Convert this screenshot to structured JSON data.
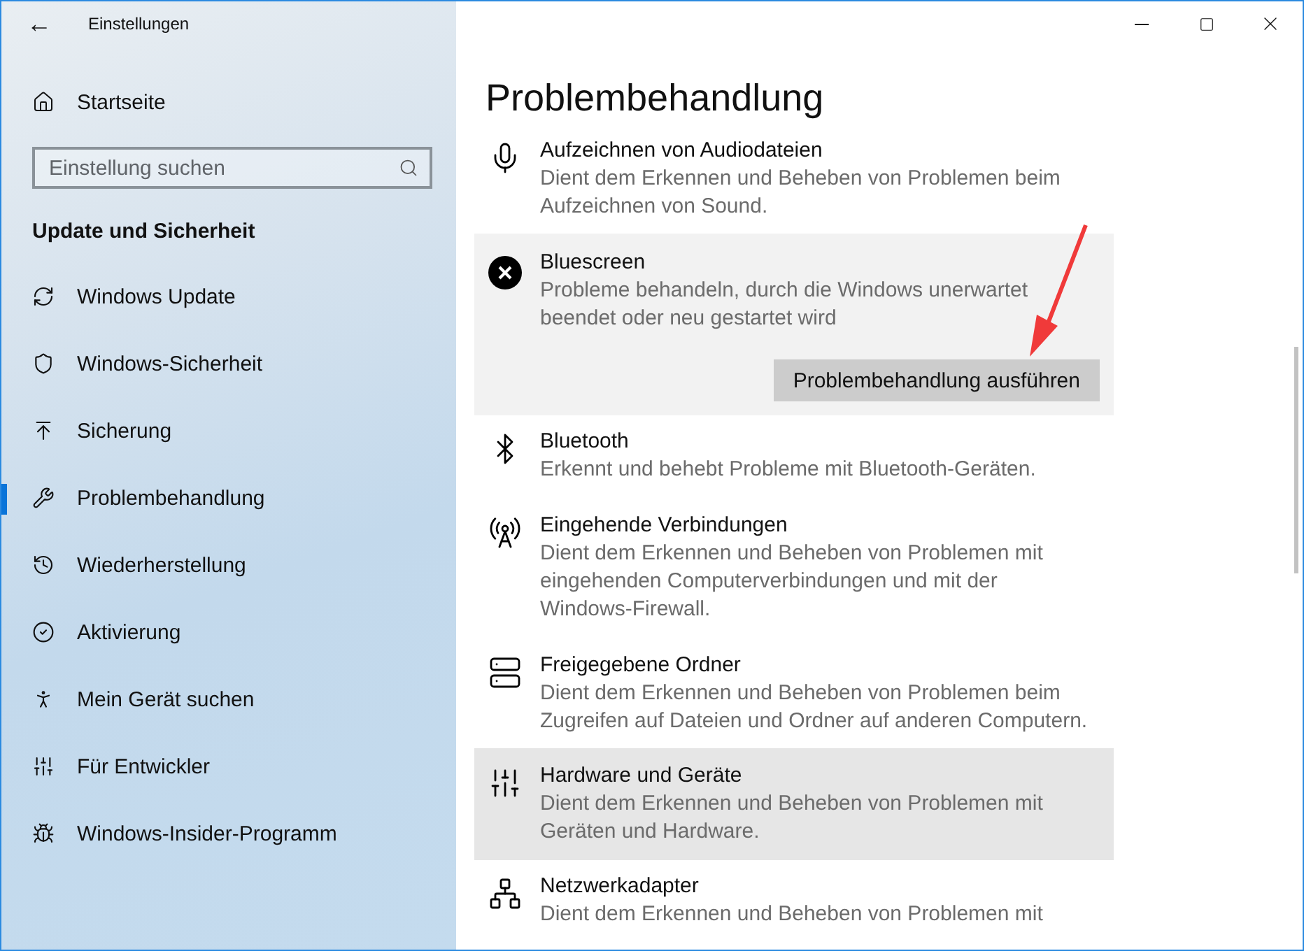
{
  "window": {
    "title": "Einstellungen",
    "back": "←"
  },
  "sidebar": {
    "home": "Startseite",
    "search": {
      "placeholder": "Einstellung suchen"
    },
    "section": "Update und Sicherheit",
    "items": [
      {
        "label": "Windows Update",
        "selected": false
      },
      {
        "label": "Windows-Sicherheit",
        "selected": false
      },
      {
        "label": "Sicherung",
        "selected": false
      },
      {
        "label": "Problembehandlung",
        "selected": true
      },
      {
        "label": "Wiederherstellung",
        "selected": false
      },
      {
        "label": "Aktivierung",
        "selected": false
      },
      {
        "label": "Mein Gerät suchen",
        "selected": false
      },
      {
        "label": "Für Entwickler",
        "selected": false
      },
      {
        "label": "Windows-Insider-Programm",
        "selected": false
      }
    ]
  },
  "content": {
    "heading": "Problembehandlung",
    "items": [
      {
        "title": "Aufzeichnen von Audiodateien",
        "description": "Dient dem Erkennen und Beheben von Problemen beim Aufzeichnen von Sound.",
        "expanded": false,
        "highlighted": false
      },
      {
        "title": "Bluescreen",
        "description": "Probleme behandeln, durch die Windows unerwartet beendet oder neu gestartet wird",
        "expanded": true,
        "highlighted": false,
        "button": "Problembehandlung ausführen"
      },
      {
        "title": "Bluetooth",
        "description": "Erkennt und behebt Probleme mit Bluetooth-Geräten.",
        "expanded": false,
        "highlighted": false
      },
      {
        "title": "Eingehende Verbindungen",
        "description": "Dient dem Erkennen und Beheben von Problemen mit eingehenden Computerverbindungen und mit der Windows-Firewall.",
        "expanded": false,
        "highlighted": false
      },
      {
        "title": "Freigegebene Ordner",
        "description": "Dient dem Erkennen und Beheben von Problemen beim Zugreifen auf Dateien und Ordner auf anderen Computern.",
        "expanded": false,
        "highlighted": false
      },
      {
        "title": "Hardware und Geräte",
        "description": "Dient dem Erkennen und Beheben von Problemen mit Geräten und Hardware.",
        "expanded": false,
        "highlighted": true
      },
      {
        "title": "Netzwerkadapter",
        "description": "Dient dem Erkennen und Beheben von Problemen mit",
        "expanded": false,
        "highlighted": false
      }
    ]
  }
}
